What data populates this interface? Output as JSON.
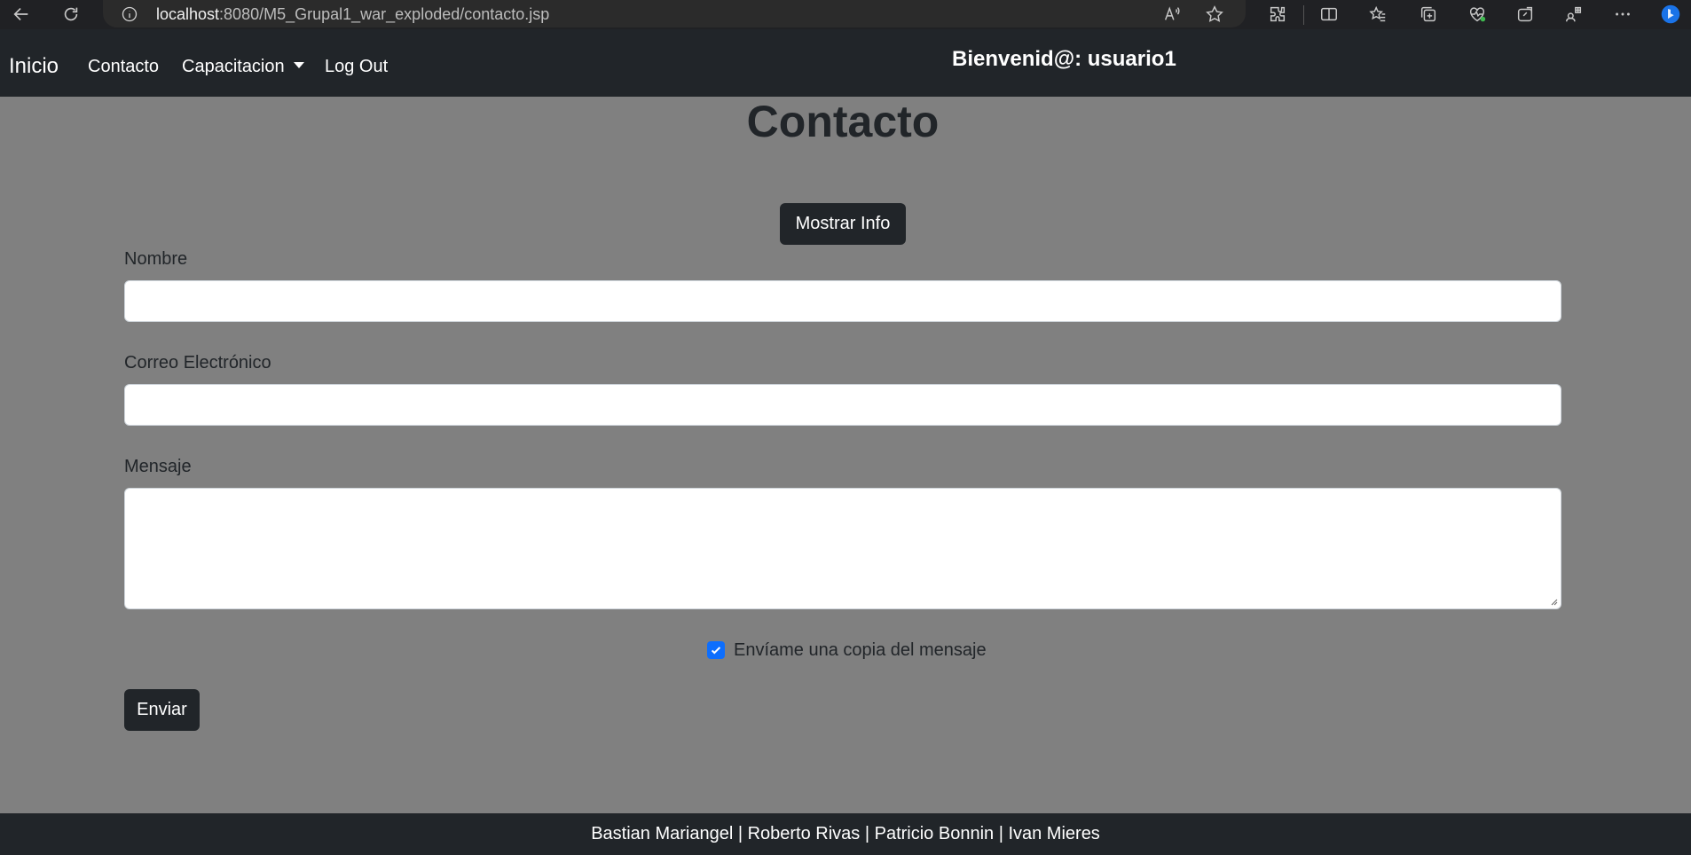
{
  "browser": {
    "url_host": "localhost",
    "url_path": ":8080/M5_Grupal1_war_exploded/contacto.jsp"
  },
  "navbar": {
    "brand": "Inicio",
    "links": [
      {
        "label": "Contacto"
      },
      {
        "label": "Capacitacion"
      },
      {
        "label": "Log Out"
      }
    ],
    "welcome": "Bienvenid@: usuario1"
  },
  "main": {
    "title": "Contacto",
    "info_button": "Mostrar Info",
    "form": {
      "name_label": "Nombre",
      "name_value": "",
      "email_label": "Correo Electrónico",
      "email_value": "",
      "message_label": "Mensaje",
      "message_value": "",
      "copy_checkbox_label": "Envíame una copia del mensaje",
      "copy_checked": true,
      "submit_label": "Enviar"
    }
  },
  "footer": {
    "credits": "Bastian Mariangel | Roberto Rivas | Patricio Bonnin | Ivan Mieres"
  },
  "colors": {
    "navbar_bg": "#212529",
    "page_bg": "#808080",
    "checkbox_accent": "#0d6efd"
  }
}
